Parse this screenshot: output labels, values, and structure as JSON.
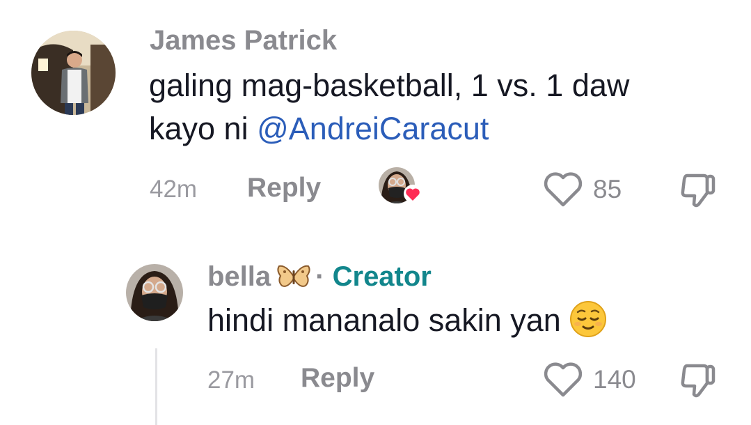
{
  "comments": [
    {
      "username": "James Patrick",
      "text": "galing mag-basketball, 1 vs. 1 daw",
      "text_line2_prefix": "kayo ni ",
      "mention": "@AndreiCaracut",
      "time": "42m",
      "reply_label": "Reply",
      "likes": "85",
      "liked_by_creator": true
    },
    {
      "username": "bella",
      "username_emoji": "butterfly-emoji",
      "separator": "·",
      "creator_label": "Creator",
      "text": "hindi mananalo sakin yan",
      "text_emoji": "relieved-face-emoji",
      "time": "27m",
      "reply_label": "Reply",
      "likes": "140"
    }
  ],
  "colors": {
    "username": "#8a8a8f",
    "text": "#161823",
    "mention": "#2b5db9",
    "creator_tag": "#12868c",
    "heart_badge": "#fe2c55"
  }
}
